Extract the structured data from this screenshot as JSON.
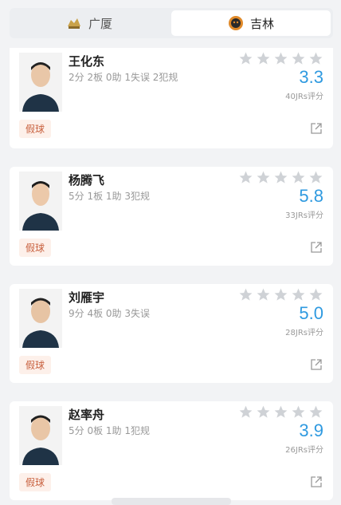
{
  "tabs": [
    {
      "label": "广厦",
      "active": false,
      "logo": "guangsha-logo-icon"
    },
    {
      "label": "吉林",
      "active": true,
      "logo": "jilin-logo-icon"
    }
  ],
  "players": [
    {
      "name": "王化东",
      "stats": "2分 2板 0助 1失误 2犯规",
      "score": "3.3",
      "count": "40JRs评分",
      "tag": "假球"
    },
    {
      "name": "杨腾飞",
      "stats": "5分 1板 1助 3犯规",
      "score": "5.8",
      "count": "33JRs评分",
      "tag": "假球"
    },
    {
      "name": "刘雁宇",
      "stats": "9分 4板 0助 3失误",
      "score": "5.0",
      "count": "28JRs评分",
      "tag": "假球"
    },
    {
      "name": "赵率舟",
      "stats": "5分 0板 1助 1犯规",
      "score": "3.9",
      "count": "26JRs评分",
      "tag": "假球"
    }
  ],
  "colors": {
    "accent": "#2f9ae0",
    "tag_bg": "#fdf0ea",
    "tag_text": "#c8603e",
    "star": "#cfd2d6"
  }
}
